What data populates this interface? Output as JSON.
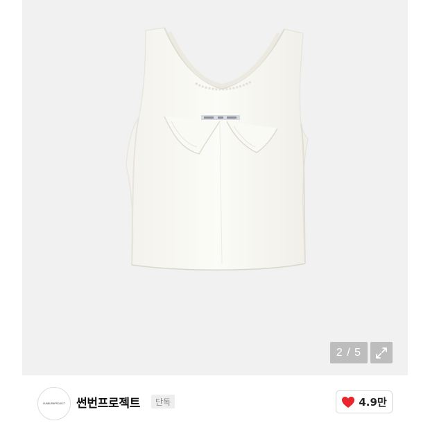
{
  "gallery": {
    "counter": "2 / 5",
    "image_label": "white sleeveless top product photo",
    "expand_icon": "expand-arrows-icon"
  },
  "seller": {
    "logo_text": "SUNBURNPROJECT",
    "name": "썬번프로젝트",
    "badge": "단독"
  },
  "like": {
    "icon": "heart-icon",
    "count": "4.9만",
    "color": "#e8262b"
  }
}
